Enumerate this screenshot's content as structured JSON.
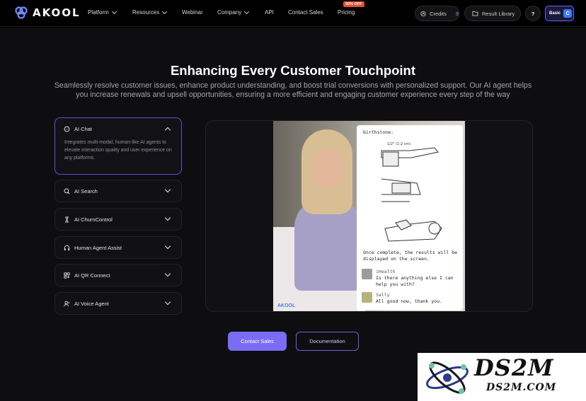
{
  "nav": {
    "logo": "AKOOL",
    "items": [
      {
        "label": "Platform",
        "dropdown": true
      },
      {
        "label": "Resources",
        "dropdown": true
      },
      {
        "label": "Webinar",
        "dropdown": false
      },
      {
        "label": "Company",
        "dropdown": true
      },
      {
        "label": "API",
        "dropdown": false
      },
      {
        "label": "Contact Sales",
        "dropdown": false
      },
      {
        "label": "Pricing",
        "dropdown": false
      }
    ],
    "promo_badge": "30% OFF",
    "credits_label": "Credits",
    "credits_value": "9",
    "result_library": "Result Library",
    "help": "?",
    "plan": "Basic",
    "avatar_letter": "C"
  },
  "hero": {
    "title": "Enhancing Every Customer Touchpoint",
    "subtitle": "Seamlessly resolve customer issues, enhance product understanding, and boost trial conversions with personalized support. Our AI agent helps you increase renewals and upsell opportunities, ensuring a more efficient and engaging customer experience every step of the way"
  },
  "features": [
    {
      "label": "AI Chat",
      "icon": "chat-icon",
      "expanded": true,
      "description": "Integrates multi-modal, human-like AI agents to elevate interaction quality and user experience on any platforms."
    },
    {
      "label": "AI Search",
      "icon": "search-icon",
      "expanded": false
    },
    {
      "label": "AI ChurnControl",
      "icon": "hourglass-icon",
      "expanded": false
    },
    {
      "label": "Human Agent Assist",
      "icon": "headset-icon",
      "expanded": false
    },
    {
      "label": "AI QR Connect",
      "icon": "qr-icon",
      "expanded": false
    },
    {
      "label": "AI Voice Agent",
      "icon": "voice-agent-icon",
      "expanded": false
    }
  ],
  "demo": {
    "card_caption": "birthstone:",
    "card_measure": "1/2\" (1-2 cm)",
    "card_done": "Once complete, the results will be displayed on the screen.",
    "messages": [
      {
        "name": "iHealth",
        "text": "Is there anything else I can help you with?"
      },
      {
        "name": "Sally",
        "text": "All good now, thank you."
      }
    ],
    "watermark": "AKOOL"
  },
  "cta": {
    "primary": "Contact Sales",
    "secondary": "Documentation"
  },
  "stamp": {
    "brand": "DS2M",
    "domain": "DS2M.COM"
  },
  "colors": {
    "accent": "#7b6cf6",
    "promo": "#e2502e",
    "background": "#0e0e10"
  }
}
